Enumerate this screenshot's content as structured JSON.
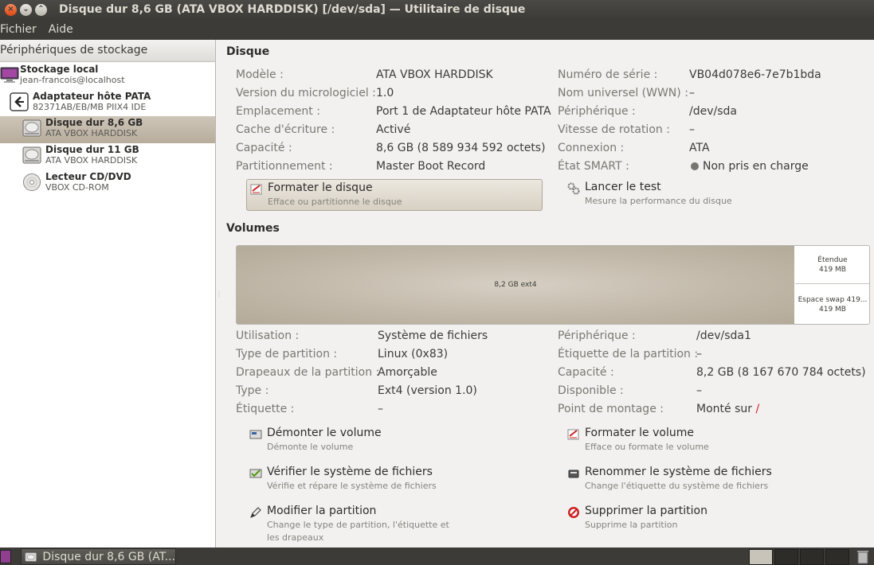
{
  "window": {
    "title": "Disque dur 8,6 GB (ATA VBOX HARDDISK) [/dev/sda] — Utilitaire de disque"
  },
  "menu": [
    "Fichier",
    "Aide"
  ],
  "sidebar": {
    "header": "Périphériques de stockage",
    "items": [
      {
        "title": "Stockage local",
        "subtitle": "jean-francois@localhost",
        "icon": "computer-icon"
      },
      {
        "title": "Adaptateur hôte PATA",
        "subtitle": "82371AB/EB/MB PIIX4 IDE",
        "icon": "controller-icon"
      },
      {
        "title": "Disque dur 8,6 GB",
        "subtitle": "ATA VBOX HARDDISK",
        "icon": "harddisk-icon",
        "selected": true
      },
      {
        "title": "Disque dur 11 GB",
        "subtitle": "ATA VBOX HARDDISK",
        "icon": "harddisk-icon"
      },
      {
        "title": "Lecteur CD/DVD",
        "subtitle": "VBOX CD-ROM",
        "icon": "optical-disc-icon"
      }
    ]
  },
  "disk": {
    "section_title": "Disque",
    "left": [
      {
        "label": "Modèle :",
        "value": "ATA VBOX HARDDISK"
      },
      {
        "label": "Version du micrologiciel :",
        "value": "1.0"
      },
      {
        "label": "Emplacement :",
        "value": "Port 1 de Adaptateur hôte PATA"
      },
      {
        "label": "Cache d'écriture :",
        "value": "Activé"
      },
      {
        "label": "Capacité :",
        "value": "8,6 GB (8 589 934 592 octets)"
      },
      {
        "label": "Partitionnement :",
        "value": "Master Boot Record"
      }
    ],
    "right": [
      {
        "label": "Numéro de série :",
        "value": "VB04d078e6-7e7b1bda"
      },
      {
        "label": "Nom universel (WWN) :",
        "value": "–"
      },
      {
        "label": "Périphérique :",
        "value": "/dev/sda"
      },
      {
        "label": "Vitesse de rotation :",
        "value": "–"
      },
      {
        "label": "Connexion :",
        "value": "ATA"
      },
      {
        "label": "État SMART :",
        "value": "Non pris en charge"
      }
    ],
    "actions": [
      {
        "title": "Formater le disque",
        "desc": "Efface ou partitionne le disque"
      },
      {
        "title": "Lancer le test",
        "desc": "Mesure la performance du disque"
      }
    ]
  },
  "volumes": {
    "section_title": "Volumes",
    "main_label": "8,2 GB ext4",
    "extended": {
      "name": "Étendue",
      "size": "419 MB"
    },
    "swap": {
      "name": "Espace swap 419...",
      "size": "419 MB"
    },
    "left": [
      {
        "label": "Utilisation :",
        "value": "Système de fichiers"
      },
      {
        "label": "Type de partition :",
        "value": "Linux (0x83)"
      },
      {
        "label": "Drapeaux de la partition :",
        "value": "Amorçable"
      },
      {
        "label": "Type :",
        "value": "Ext4 (version 1.0)"
      },
      {
        "label": "Étiquette :",
        "value": "–"
      }
    ],
    "right": [
      {
        "label": "Périphérique :",
        "value": "/dev/sda1"
      },
      {
        "label": "Étiquette de la partition :",
        "value": "–"
      },
      {
        "label": "Capacité :",
        "value": "8,2 GB (8 167 670 784 octets)"
      },
      {
        "label": "Disponible :",
        "value": "–"
      },
      {
        "label": "Point de montage :",
        "value": "Monté sur ",
        "link": "/"
      }
    ],
    "actions": [
      {
        "title": "Démonter le volume",
        "desc": "Démonte le volume"
      },
      {
        "title": "Formater le volume",
        "desc": "Efface ou formate le volume"
      },
      {
        "title": "Vérifier le système de fichiers",
        "desc": "Vérifie et répare le système de fichiers"
      },
      {
        "title": "Renommer le système de fichiers",
        "desc": "Change l'étiquette du système de fichiers"
      },
      {
        "title": "Modifier la partition",
        "desc": "Change le type de partition, l'étiquette et",
        "desc2": "les drapeaux"
      },
      {
        "title": "Supprimer la partition",
        "desc": "Supprime la partition"
      }
    ]
  },
  "taskbar": {
    "window_label": "Disque dur 8,6 GB (AT..."
  }
}
